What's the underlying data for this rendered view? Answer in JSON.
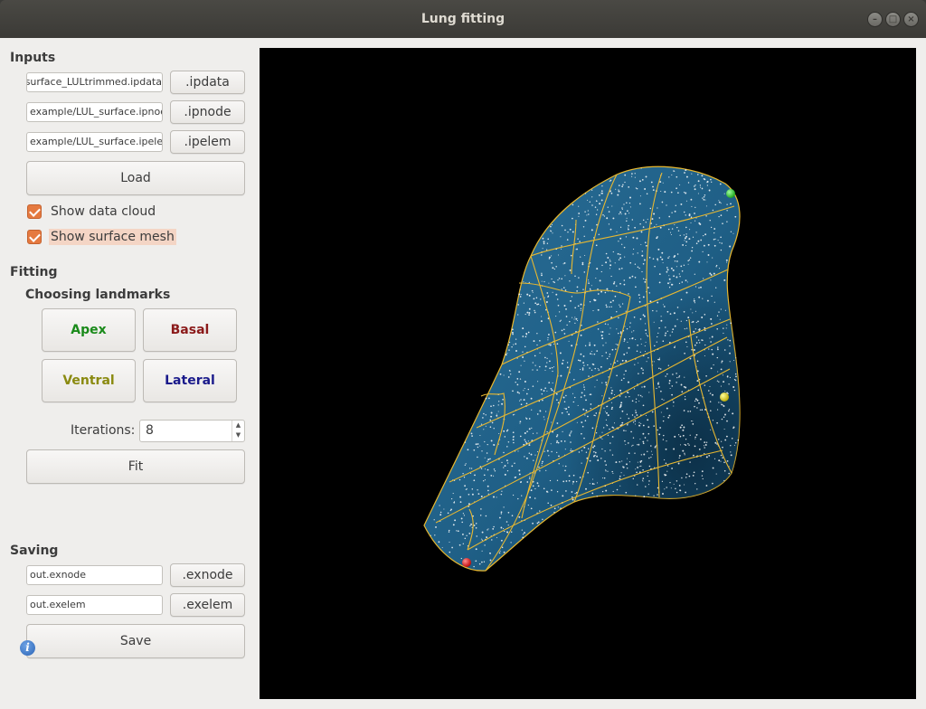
{
  "window": {
    "title": "Lung fitting"
  },
  "inputs": {
    "heading": "Inputs",
    "ipdata_path": "e/surface_LULtrimmed.ipdata",
    "ipdata_button": ".ipdata",
    "ipnode_path": "example/LUL_surface.ipnode",
    "ipnode_button": ".ipnode",
    "ipelem_path": "example/LUL_surface.ipelem",
    "ipelem_button": ".ipelem",
    "load_button": "Load",
    "show_data_cloud": {
      "label": "Show data cloud",
      "checked": true
    },
    "show_surface_mesh": {
      "label": "Show surface mesh",
      "checked": true
    }
  },
  "fitting": {
    "heading": "Fitting",
    "landmarks_heading": "Choosing landmarks",
    "apex": {
      "label": "Apex",
      "color": "#1a8a1a"
    },
    "basal": {
      "label": "Basal",
      "color": "#8b1a1a"
    },
    "ventral": {
      "label": "Ventral",
      "color": "#8a8a10"
    },
    "lateral": {
      "label": "Lateral",
      "color": "#1a1a8b"
    },
    "iterations_label": "Iterations:",
    "iterations_value": "8",
    "fit_button": "Fit"
  },
  "saving": {
    "heading": "Saving",
    "exnode_path": "out.exnode",
    "exnode_button": ".exnode",
    "exelem_path": "out.exelem",
    "exelem_button": ".exelem",
    "save_button": "Save"
  },
  "icons": {
    "info": "info-icon"
  },
  "viewport": {
    "background": "#000000",
    "surface_color": "#1f5f86",
    "mesh_color": "#e8b830",
    "landmark_colors": {
      "apex": "#22cc22",
      "ventral": "#e6d800",
      "basal": "#dd1a1a"
    }
  }
}
